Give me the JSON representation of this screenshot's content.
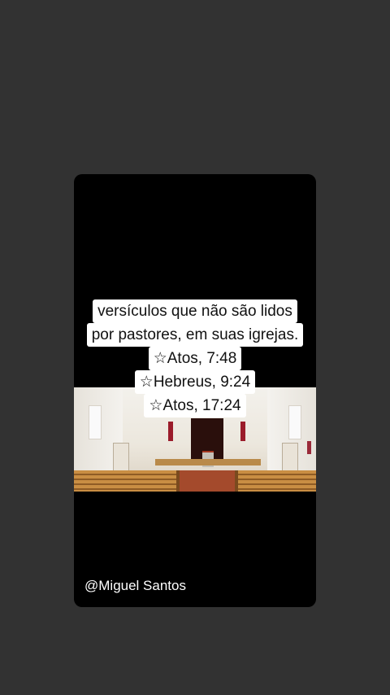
{
  "video": {
    "caption_lines": [
      "versículos que não são lidos",
      "por pastores, em suas igrejas.",
      "☆Atos, 7:48",
      "☆Hebreus, 9:24",
      "☆Atos, 17:24"
    ],
    "author_handle": "@Miguel Santos",
    "image_subject": "church-interior-photo"
  },
  "colors": {
    "page_background": "#323232",
    "card_background": "#000000",
    "caption_background": "#ffffff",
    "caption_text": "#111111"
  }
}
